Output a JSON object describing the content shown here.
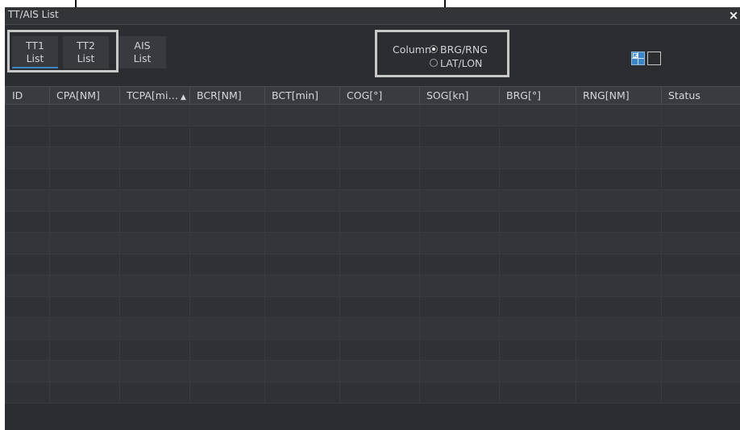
{
  "window": {
    "title": "TT/AIS List",
    "close_label": "×"
  },
  "tabs": [
    {
      "line1": "TT1",
      "line2": "List",
      "active": true
    },
    {
      "line1": "TT2",
      "line2": "List",
      "active": false
    },
    {
      "line1": "AIS",
      "line2": "List",
      "active": false
    }
  ],
  "column_select": {
    "label": "Column",
    "options": [
      {
        "label": "BRG/RNG",
        "checked": true
      },
      {
        "label": "LAT/LON",
        "checked": false
      }
    ]
  },
  "view_icons": [
    "list-view-icon",
    "single-view-icon"
  ],
  "table": {
    "headers": [
      "ID",
      "CPA[NM]",
      "TCPA[mi…",
      "BCR[NM]",
      "BCT[min]",
      "COG[°]",
      "SOG[kn]",
      "BRG[°]",
      "RNG[NM]",
      "Status"
    ],
    "sort_indicator": "▲",
    "row_count": 14
  }
}
